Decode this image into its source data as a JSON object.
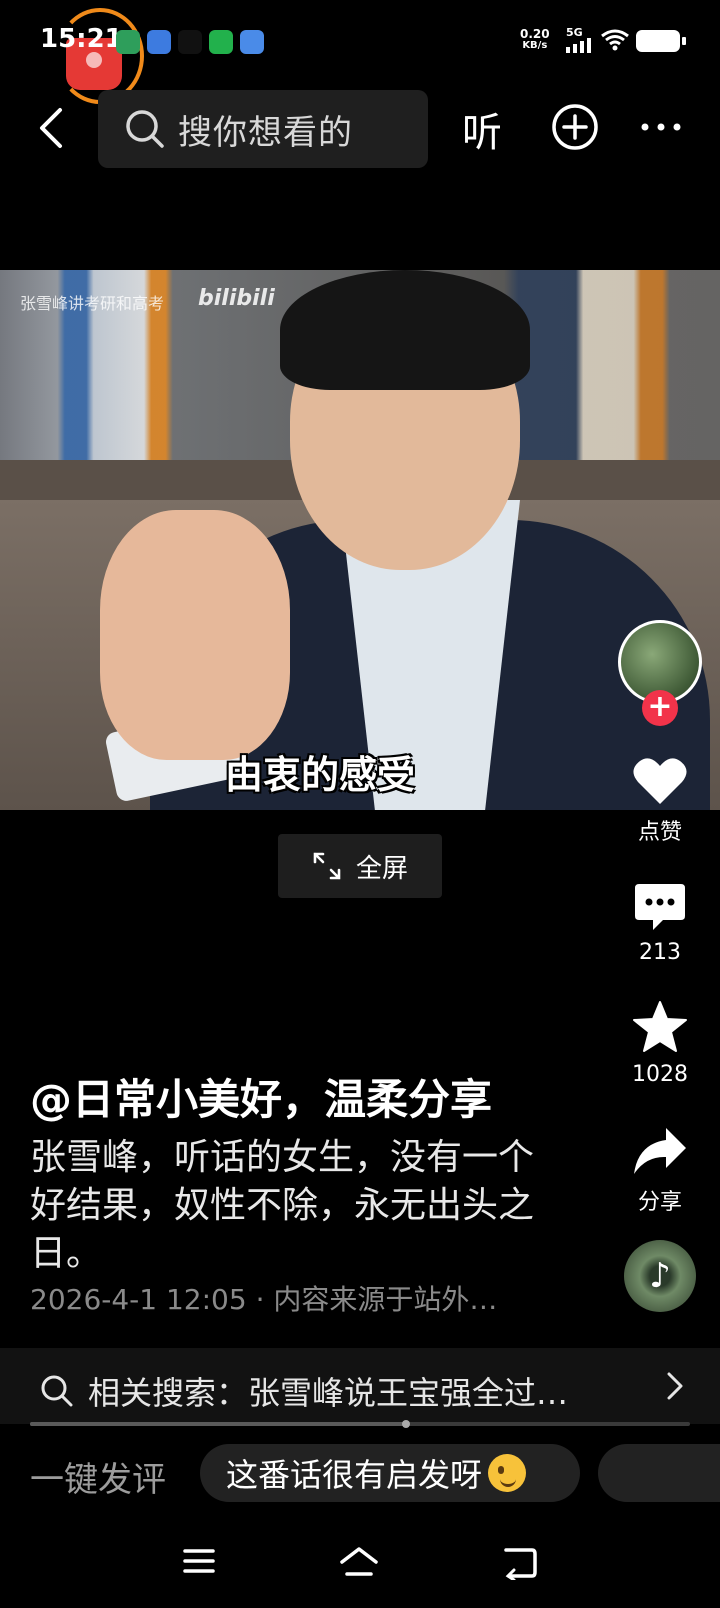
{
  "status_bar": {
    "time": "15:21",
    "net_speed_value": "0.20",
    "net_speed_unit": "KB/s",
    "network": "5G",
    "app_icon_colors": [
      "#2e9e5b",
      "#3d7be0",
      "#111111",
      "#22b14c",
      "#4a8be8"
    ]
  },
  "top_nav": {
    "search_placeholder": "搜你想看的",
    "listen_label": "听"
  },
  "video": {
    "watermark": "张雪峰讲考研和高考",
    "watermark_logo": "bilibili",
    "subtitle": "由衷的感受"
  },
  "fullscreen": {
    "label": "全屏"
  },
  "rail": {
    "like_label": "点赞",
    "comment_count": "213",
    "favorite_count": "1028",
    "share_label": "分享"
  },
  "caption": {
    "author": "@日常小美好，温柔分享",
    "description": "张雪峰，听话的女生，没有一个好结果，奴性不除，永无出头之日。",
    "meta": "2026-4-1 12:05 · 内容来源于站外…"
  },
  "related_search": {
    "text": "相关搜索：张雪峰说王宝强全过…",
    "progress": 0.57
  },
  "quick_comment": {
    "label": "一键发评",
    "chip_text": "这番话很有启发呀"
  }
}
